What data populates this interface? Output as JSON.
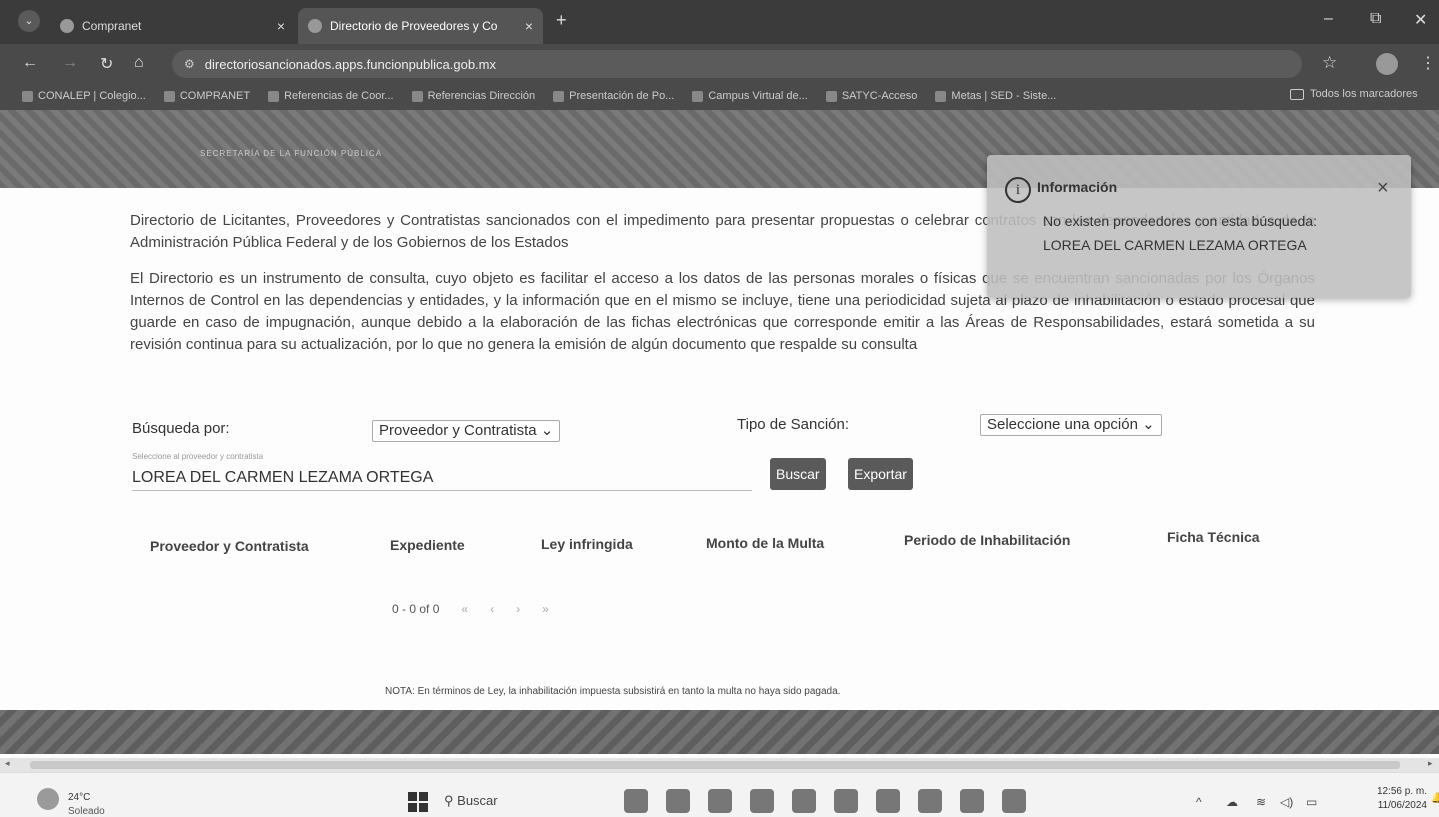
{
  "browser": {
    "tabs": [
      {
        "label": "Compranet",
        "close": "×"
      },
      {
        "label": "Directorio de Proveedores y Co",
        "close": "×"
      }
    ],
    "new_tab": "+",
    "url": "directoriosancionados.apps.funcionpublica.gob.mx",
    "bookmarks": [
      "CONALEP | Colegio...",
      "COMPRANET",
      "Referencias de Coor...",
      "Referencias Dirección",
      "Presentación de Po...",
      "Campus Virtual de...",
      "SATYC-Acceso",
      "Metas | SED - Siste..."
    ],
    "all_bookmarks": "Todos los marcadores"
  },
  "site": {
    "header_text": "SECRETARÍA DE LA FUNCIÓN PÚBLICA",
    "intro_1": "Directorio de Licitantes, Proveedores y Contratistas sancionados con el impedimento para presentar propuestas o celebrar contratos con las dependencias y entidades de la Administración Pública Federal y de los Gobiernos de los Estados",
    "intro_2": "El Directorio es un instrumento de consulta, cuyo objeto es facilitar el acceso a los datos de las personas morales o físicas que se encuentran sancionadas por los Órganos Internos de Control en las dependencias y entidades, y la información que en el mismo se incluye, tiene una periodicidad sujeta al plazo de inhabilitación o estado procesal que guarde en caso de impugnación, aunque debido a la elaboración de las fichas electrónicas que corresponde emitir a las Áreas de Responsabilidades, estará sometida a su revisión continua para su actualización, por lo que no genera la emisión de algún documento que respalde su consulta",
    "busqueda_label": "Búsqueda por:",
    "busqueda_value": "Proveedor y Contratista",
    "tipo_label": "Tipo de Sanción:",
    "tipo_value": "Seleccione una opción",
    "search_hint": "Seleccione al proveedor y contratista",
    "search_value": "LOREA DEL CARMEN LEZAMA ORTEGA",
    "buscar": "Buscar",
    "exportar": "Exportar",
    "columns": [
      "Proveedor y Contratista",
      "Expediente",
      "Ley infringida",
      "Monto de la Multa",
      "Periodo de Inhabilitación",
      "Ficha Técnica"
    ],
    "pager": {
      "range": "0 - 0 of 0",
      "first": "«",
      "prev": "‹",
      "next": "›",
      "last": "»"
    },
    "nota": "NOTA: En términos de Ley, la inhabilitación impuesta subsistirá en tanto la multa no haya sido pagada."
  },
  "toast": {
    "title": "Información",
    "message": "No existen proveedores con esta búsqueda: LOREA DEL CARMEN LEZAMA ORTEGA",
    "close": "×"
  },
  "taskbar": {
    "temperature": "24°C",
    "condition": "Soleado",
    "search": "Buscar",
    "time": "12:56 p. m.",
    "date": "11/06/2024"
  }
}
